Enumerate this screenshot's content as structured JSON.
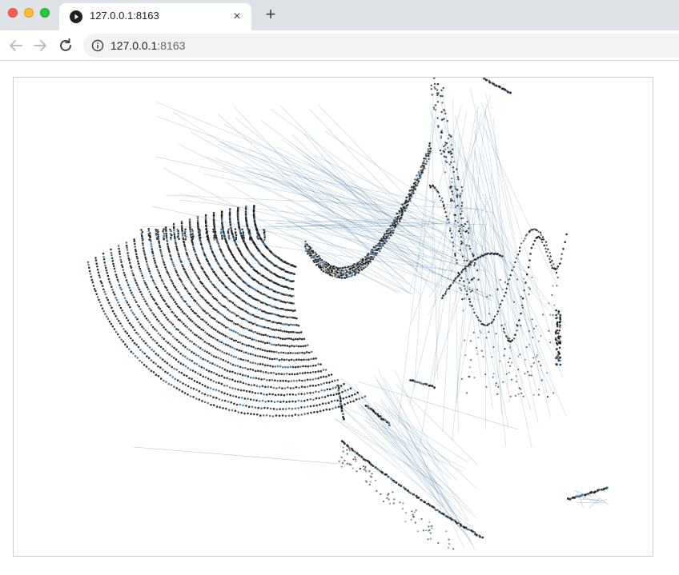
{
  "browser": {
    "tab_title": "127.0.0.1:8163",
    "tab_close": "×",
    "new_tab": "+",
    "url_host": "127.0.0.1",
    "url_port": ":8163"
  },
  "colors": {
    "chrome_bg": "#dee1e6",
    "link_blue": "#1f5f8b",
    "dot_dark": "#111111",
    "dot_gray": "#555555",
    "dot_blue": "#2a6f9e"
  },
  "icons": {
    "back": "arrow-left-icon",
    "forward": "arrow-right-icon",
    "reload": "reload-icon",
    "info": "info-icon",
    "favicon": "play-favicon-icon"
  }
}
